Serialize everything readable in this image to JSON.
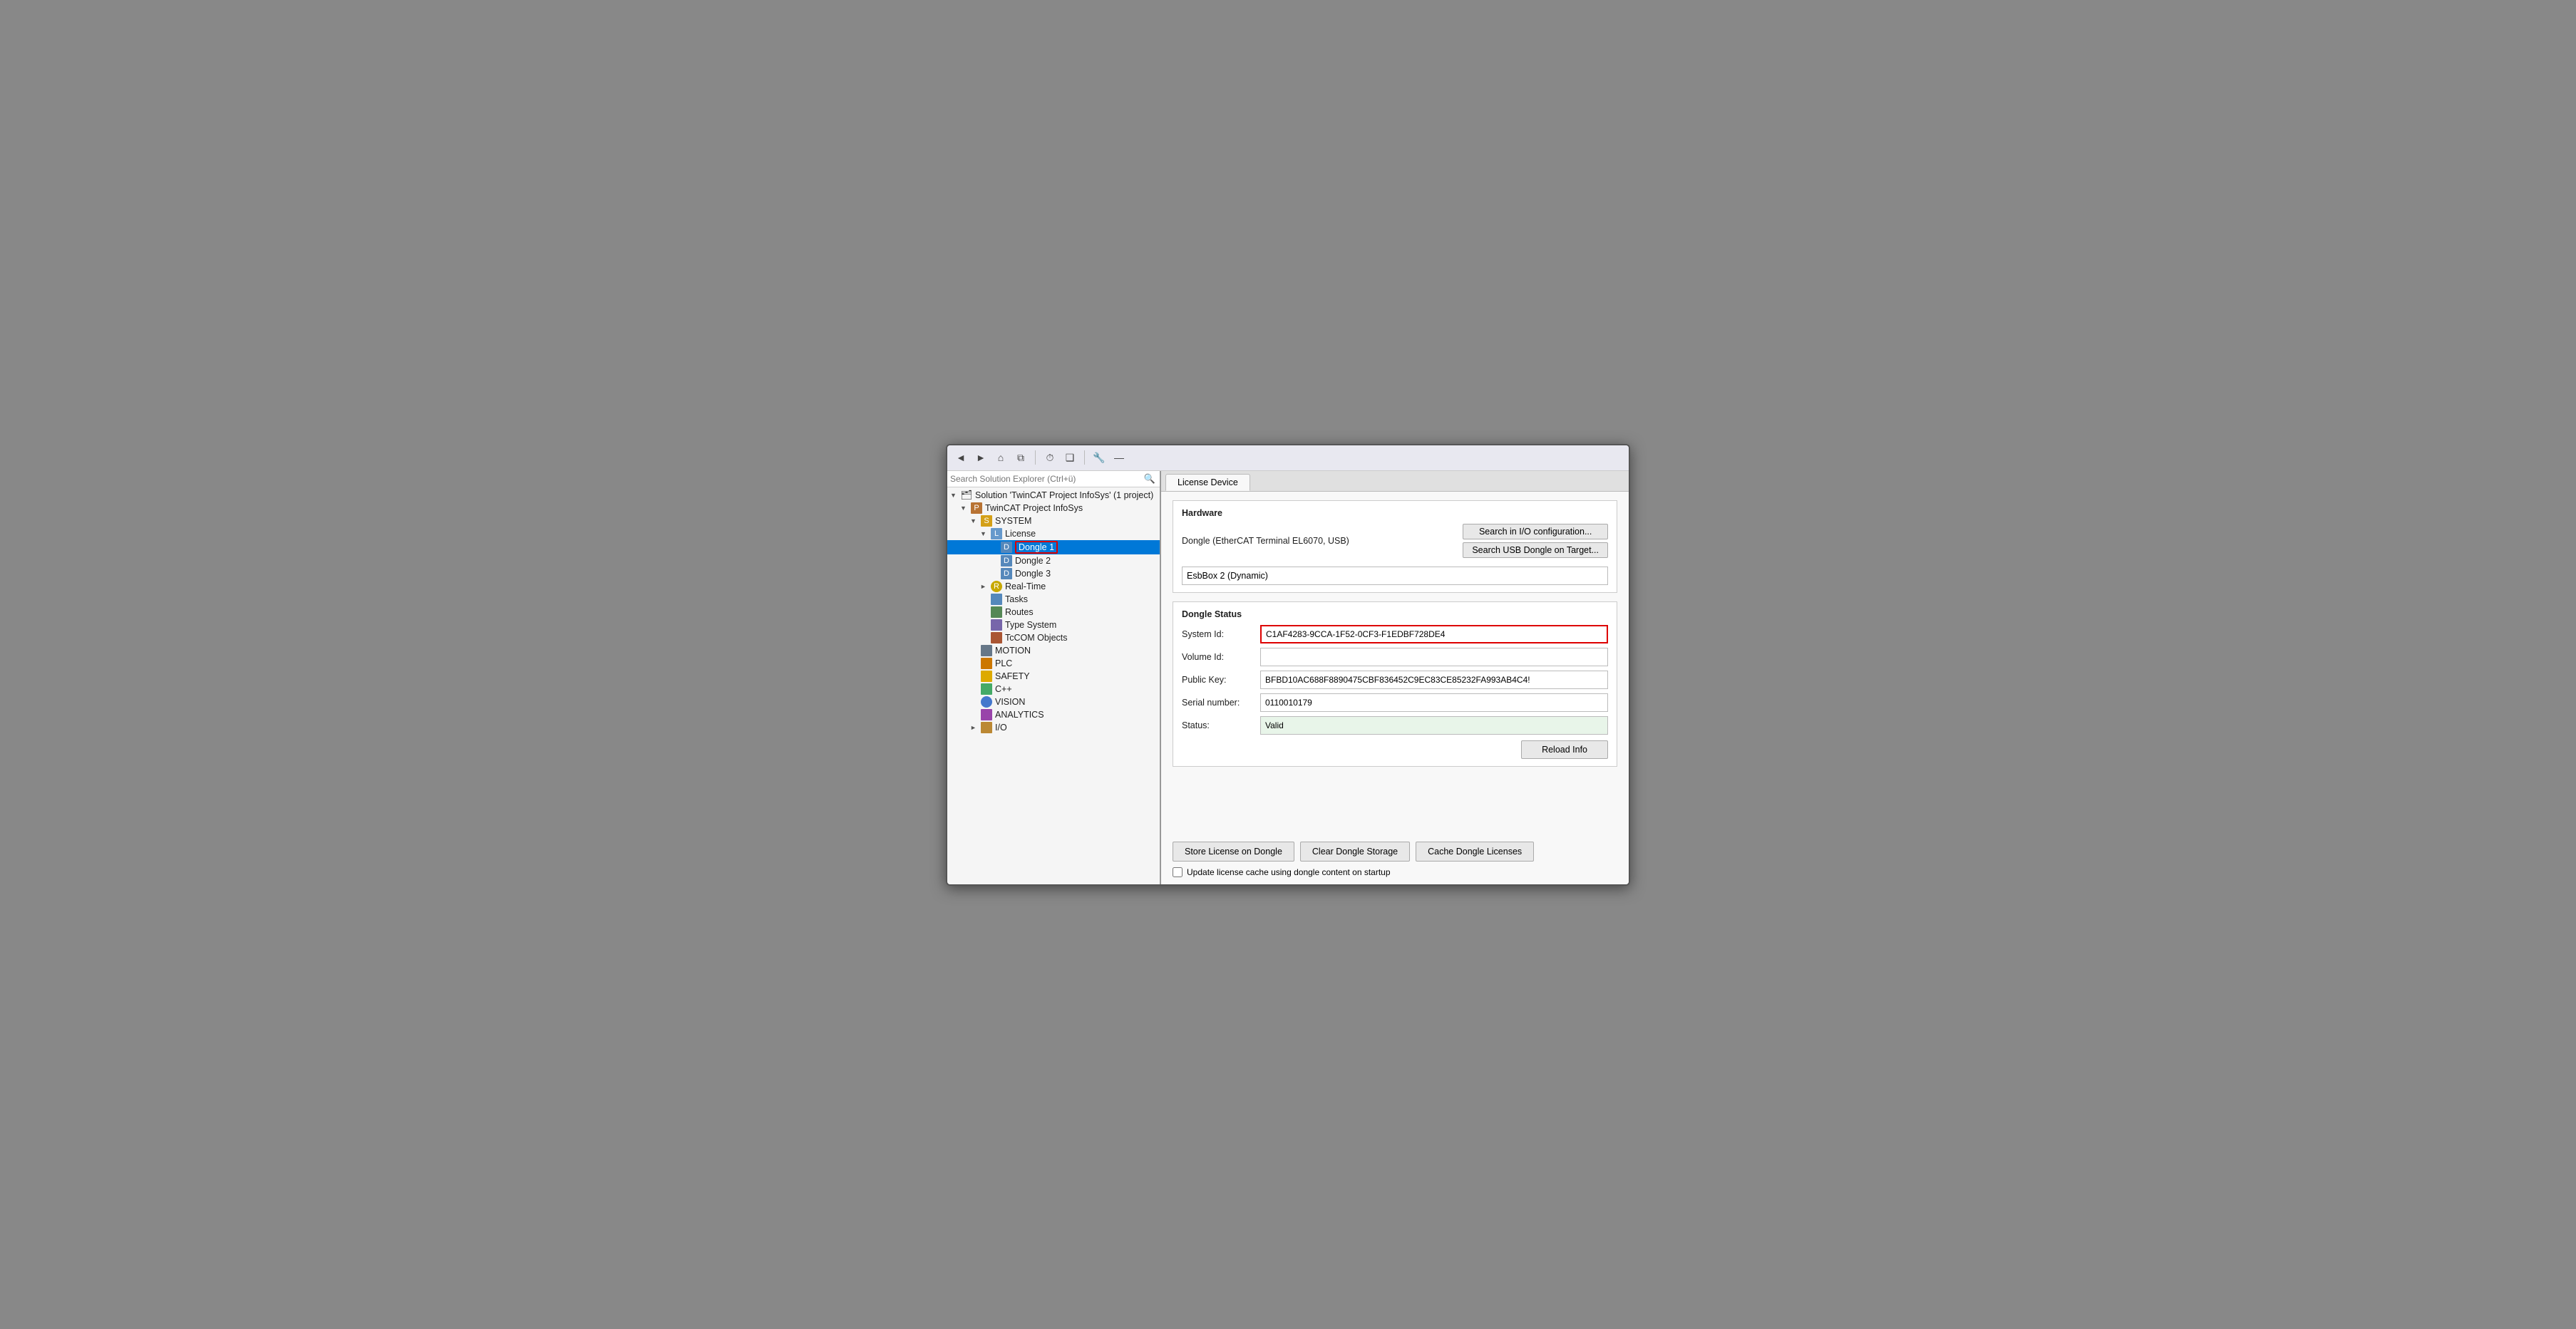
{
  "toolbar": {
    "back_label": "◄",
    "forward_label": "►",
    "home_label": "⌂",
    "copy_label": "⧉",
    "history_label": "⏱",
    "pages_label": "❑",
    "settings_label": "🔧",
    "minus_label": "—"
  },
  "solution_explorer": {
    "search_placeholder": "Search Solution Explorer (Ctrl+ü)",
    "items": [
      {
        "id": "solution",
        "label": "Solution 'TwinCAT Project InfoSys' (1 project)",
        "indent": 0,
        "icon": "solution",
        "expand": "▼",
        "selected": false
      },
      {
        "id": "twincat-project",
        "label": "TwinCAT Project InfoSys",
        "indent": 1,
        "icon": "project",
        "expand": "▼",
        "selected": false
      },
      {
        "id": "system",
        "label": "SYSTEM",
        "indent": 2,
        "icon": "system",
        "expand": "▼",
        "selected": false
      },
      {
        "id": "license",
        "label": "License",
        "indent": 3,
        "icon": "license",
        "expand": "▼",
        "selected": false
      },
      {
        "id": "dongle1",
        "label": "Dongle 1",
        "indent": 4,
        "icon": "dongle",
        "expand": "",
        "selected": true
      },
      {
        "id": "dongle2",
        "label": "Dongle 2",
        "indent": 4,
        "icon": "dongle",
        "expand": "",
        "selected": false
      },
      {
        "id": "dongle3",
        "label": "Dongle 3",
        "indent": 4,
        "icon": "dongle",
        "expand": "",
        "selected": false
      },
      {
        "id": "realtime",
        "label": "Real-Time",
        "indent": 3,
        "icon": "realtime",
        "expand": "►",
        "selected": false
      },
      {
        "id": "tasks",
        "label": "Tasks",
        "indent": 3,
        "icon": "tasks",
        "expand": "",
        "selected": false
      },
      {
        "id": "routes",
        "label": "Routes",
        "indent": 3,
        "icon": "routes",
        "expand": "",
        "selected": false
      },
      {
        "id": "typesystem",
        "label": "Type System",
        "indent": 3,
        "icon": "type",
        "expand": "",
        "selected": false
      },
      {
        "id": "tccom",
        "label": "TcCOM Objects",
        "indent": 3,
        "icon": "tccom",
        "expand": "",
        "selected": false
      },
      {
        "id": "motion",
        "label": "MOTION",
        "indent": 2,
        "icon": "motion",
        "expand": "",
        "selected": false
      },
      {
        "id": "plc",
        "label": "PLC",
        "indent": 2,
        "icon": "plc",
        "expand": "",
        "selected": false
      },
      {
        "id": "safety",
        "label": "SAFETY",
        "indent": 2,
        "icon": "safety",
        "expand": "",
        "selected": false
      },
      {
        "id": "cpp",
        "label": "C++",
        "indent": 2,
        "icon": "cpp",
        "expand": "",
        "selected": false
      },
      {
        "id": "vision",
        "label": "VISION",
        "indent": 2,
        "icon": "vision",
        "expand": "",
        "selected": false
      },
      {
        "id": "analytics",
        "label": "ANALYTICS",
        "indent": 2,
        "icon": "analytics",
        "expand": "",
        "selected": false
      },
      {
        "id": "io",
        "label": "I/O",
        "indent": 2,
        "icon": "io",
        "expand": "►",
        "selected": false
      }
    ]
  },
  "right_panel": {
    "tab_label": "License Device",
    "hardware": {
      "section_title": "Hardware",
      "dongle_label": "Dongle (EtherCAT Terminal EL6070, USB)",
      "search_io_btn": "Search in I/O configuration...",
      "search_usb_btn": "Search USB Dongle on Target...",
      "device_value": "EsbBox 2 (Dynamic)"
    },
    "dongle_status": {
      "section_title": "Dongle Status",
      "system_id_label": "System Id:",
      "system_id_value": "C1AF4283-9CCA-1F52-0CF3-F1EDBF728DE4",
      "volume_id_label": "Volume Id:",
      "volume_id_value": "",
      "public_key_label": "Public Key:",
      "public_key_value": "BFBD10AC688F8890475CBF836452C9EC83CE85232FA993AB4C4!",
      "serial_number_label": "Serial number:",
      "serial_number_value": "0110010179",
      "status_label": "Status:",
      "status_value": "Valid",
      "reload_btn": "Reload Info"
    },
    "bottom": {
      "store_btn": "Store License on Dongle",
      "clear_btn": "Clear Dongle Storage",
      "cache_btn": "Cache Dongle Licenses",
      "checkbox_label": "Update license cache using dongle content on startup"
    }
  }
}
